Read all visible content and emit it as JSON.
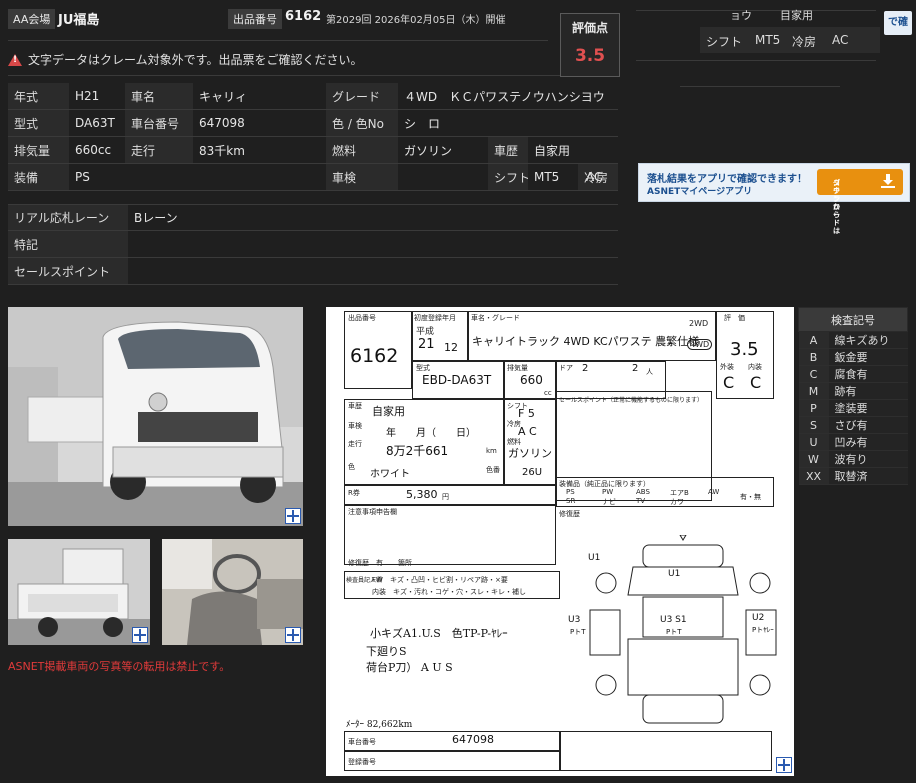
{
  "header": {
    "venue_label": "AA会場",
    "venue": "JU福島",
    "lot_label": "出品番号",
    "lot_number": "6162",
    "session": "第2029回 2026年02月05日（木）開催",
    "notice": "文字データはクレーム対象外です。出品票をご確認ください。",
    "score_label": "評価点",
    "score": "3.5"
  },
  "specs": {
    "rows": [
      [
        {
          "k": "年式",
          "v": "H21"
        },
        {
          "k": "車名",
          "v": "キャリィ"
        },
        {
          "k": "グレード",
          "v": "４WD　ＫＣパワステノウハンシヨウ"
        }
      ],
      [
        {
          "k": "型式",
          "v": "DA63T"
        },
        {
          "k": "車台番号",
          "v": "647098"
        },
        {
          "k": "色 / 色No",
          "v": "シ　ロ"
        }
      ],
      [
        {
          "k": "排気量",
          "v": "660cc"
        },
        {
          "k": "走行",
          "v": "83千km"
        },
        {
          "k": "燃料",
          "v": "ガソリン"
        },
        {
          "k": "車歴",
          "v": "自家用"
        }
      ],
      [
        {
          "k": "装備",
          "v": "PS"
        },
        {
          "k": "車検",
          "v": ""
        },
        {
          "k": "シフト",
          "v": "MT5"
        },
        {
          "k": "冷房",
          "v": "AC"
        }
      ]
    ],
    "extra": [
      {
        "k": "リアル応札レーン",
        "v": "Bレーン"
      },
      {
        "k": "特記",
        "v": ""
      },
      {
        "k": "セールスポイント",
        "v": ""
      }
    ]
  },
  "top_right": {
    "row1": [
      "ョウ",
      "目家用"
    ],
    "row2": [
      {
        "k": "シフト",
        "v": "MT5"
      },
      {
        "k": "冷房",
        "v": "AC"
      }
    ],
    "corner_button": "で確"
  },
  "banner": {
    "line1": "落札結果をアプリで確認できます！",
    "line2": "ASNETマイページアプリ",
    "button_line1": "ダウンロードは",
    "button_line2": "コチラから"
  },
  "photo_notice": "ASNET掲載車両の写真等の転用は禁止です。",
  "legend": {
    "title": "検査記号",
    "items": [
      {
        "code": "A",
        "label": "線キズあり"
      },
      {
        "code": "B",
        "label": "鈑金要"
      },
      {
        "code": "C",
        "label": "腐食有"
      },
      {
        "code": "M",
        "label": "跡有"
      },
      {
        "code": "P",
        "label": "塗装要"
      },
      {
        "code": "S",
        "label": "さび有"
      },
      {
        "code": "U",
        "label": "凹み有"
      },
      {
        "code": "W",
        "label": "波有り"
      },
      {
        "code": "XX",
        "label": "取替済"
      }
    ]
  },
  "sheet": {
    "lot_label": "出品番号",
    "lot": "6162",
    "reg_label": "初度登録年月",
    "era": "平成",
    "year": "21",
    "month": "12",
    "name_label": "車名・グレード",
    "name": "キャリイトラック 4WD KCパワステ 農繁仕様",
    "drive": "2WD",
    "drive_sel": "4WD",
    "score_label": "評　価",
    "score": "3.5",
    "model_label": "型式",
    "model": "EBD-DA63T",
    "disp_label": "排気量",
    "disp": "660",
    "disp_unit": "cc",
    "doors_label": "ドア",
    "doors": "2",
    "seats": "2",
    "seats_unit": "人",
    "ext_label": "外装",
    "int_label": "内装",
    "ext": "C",
    "int": "C",
    "use_label": "車歴",
    "use": "自家用",
    "shift_label": "シフト",
    "shift": "F 5",
    "inspect_label": "車検",
    "inspect_fields": "年　　月（　　日）",
    "ac_label": "冷房",
    "ac": "A C",
    "mileage_label": "走行",
    "mileage": "8万2千661",
    "km": "km",
    "fuel_label": "燃料",
    "fuel": "ガソリン",
    "color_label": "色",
    "color": "ホワイト",
    "colorno_label": "色番",
    "colorno": "26U",
    "tax_label": "R券",
    "tax": "5,380",
    "tax_unit": "円",
    "points_label": "セールスポイント（正常に機能するものに限ります）",
    "equip_label": "装備品（純正品に限ります）",
    "equip_row1": [
      "PS",
      "PW",
      "ABS",
      "エアB",
      "AW"
    ],
    "equip_row2": [
      "SR",
      "ナビ",
      "TV",
      "カワ",
      ""
    ],
    "equip_extra": "有・無",
    "history_label": "修復歴",
    "notes_label": "注意事項申告欄",
    "repair_label": "修復歴　有",
    "repair_part": "箇所",
    "inspector_label": "検査員記入欄",
    "inspector_row1": "FW　キズ・凸凹・ヒビ割・リペア跡・×要",
    "inspector_row2": "内装　キズ・汚れ・コゲ・穴・スレ・キレ・補し",
    "handwriting": [
      "小キズA1.U.S　色TP-P-ﾔﾚｰ",
      "下廻りS",
      "荷台P刀） A U S"
    ],
    "marks": [
      "U1",
      "U1",
      "U3",
      "U3 S1",
      "U2",
      "PトT",
      "PトT",
      "Pトﾔﾚｰ"
    ],
    "odo_note": "ﾒｰﾀｰ 82,662km",
    "vin_label": "車台番号",
    "vin": "647098",
    "regno_label": "登録番号"
  }
}
